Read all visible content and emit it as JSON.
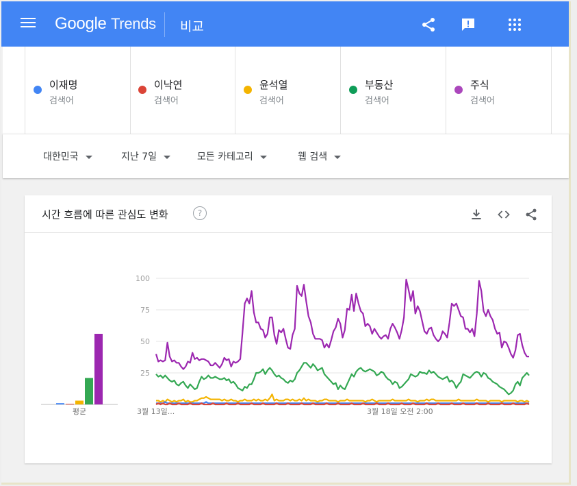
{
  "app": {
    "logo_google": "Google",
    "logo_trends": "Trends",
    "page_title": "비교",
    "icons": [
      "menu-icon",
      "share-icon",
      "feedback-icon",
      "apps-grid-icon"
    ]
  },
  "terms": [
    {
      "name": "이재명",
      "sub": "검색어",
      "color": "#4285f4"
    },
    {
      "name": "이낙연",
      "sub": "검색어",
      "color": "#db4437"
    },
    {
      "name": "윤석열",
      "sub": "검색어",
      "color": "#f4b400"
    },
    {
      "name": "부동산",
      "sub": "검색어",
      "color": "#0f9d58"
    },
    {
      "name": "주식",
      "sub": "검색어",
      "color": "#ab47bc"
    }
  ],
  "filters": {
    "region": "대한민국",
    "period": "지난 7일",
    "category": "모든 카테고리",
    "search_type": "웹 검색"
  },
  "card": {
    "title": "시간 흐름에 따른 관심도 변화",
    "help": "?"
  },
  "chart_data": {
    "type": "line",
    "ylim": [
      0,
      100
    ],
    "yticks": [
      "100",
      "75",
      "50",
      "25"
    ],
    "xtick_labels": [
      "3월 13일...",
      "3월 18일 오전 2:00"
    ],
    "average_label": "평균",
    "averages": [
      {
        "name": "이재명",
        "value": 1,
        "color": "#4285f4"
      },
      {
        "name": "이낙연",
        "value": 0,
        "color": "#db4437"
      },
      {
        "name": "윤석열",
        "value": 3,
        "color": "#f4b400"
      },
      {
        "name": "부동산",
        "value": 21,
        "color": "#34a853"
      },
      {
        "name": "주식",
        "value": 56,
        "color": "#9c27b0"
      }
    ],
    "series": [
      {
        "name": "주식",
        "color": "#9c27b0",
        "values": [
          40,
          34,
          35,
          34,
          35,
          49,
          38,
          34,
          35,
          33,
          33,
          30,
          28,
          30,
          34,
          33,
          41,
          36,
          37,
          35,
          36,
          36,
          35,
          34,
          31,
          31,
          33,
          31,
          29,
          32,
          37,
          35,
          36,
          30,
          34,
          33,
          34,
          36,
          57,
          80,
          84,
          80,
          90,
          73,
          65,
          65,
          60,
          59,
          53,
          56,
          69,
          69,
          55,
          48,
          59,
          57,
          60,
          52,
          45,
          44,
          55,
          60,
          94,
          88,
          86,
          95,
          82,
          70,
          65,
          56,
          52,
          52,
          52,
          51,
          45,
          48,
          45,
          51,
          58,
          61,
          68,
          64,
          53,
          59,
          76,
          75,
          87,
          74,
          88,
          80,
          74,
          72,
          62,
          64,
          62,
          56,
          60,
          57,
          54,
          52,
          54,
          55,
          52,
          60,
          64,
          61,
          57,
          52,
          59,
          69,
          99,
          91,
          82,
          90,
          72,
          78,
          74,
          66,
          58,
          56,
          60,
          61,
          55,
          52,
          50,
          52,
          58,
          56,
          53,
          65,
          80,
          78,
          80,
          75,
          70,
          69,
          60,
          60,
          57,
          60,
          54,
          72,
          98,
          90,
          74,
          70,
          75,
          70,
          67,
          60,
          56,
          57,
          45,
          50,
          49,
          45,
          40,
          37,
          43,
          55,
          56,
          47,
          41,
          38,
          38
        ]
      },
      {
        "name": "부동산",
        "color": "#34a853",
        "values": [
          24,
          22,
          23,
          21,
          23,
          21,
          19,
          18,
          19,
          16,
          15,
          17,
          18,
          15,
          13,
          16,
          14,
          12,
          13,
          18,
          22,
          20,
          21,
          23,
          21,
          21,
          22,
          21,
          20,
          20,
          21,
          19,
          20,
          17,
          18,
          16,
          13,
          12,
          11,
          14,
          13,
          16,
          16,
          20,
          25,
          25,
          26,
          28,
          24,
          27,
          29,
          27,
          24,
          22,
          23,
          21,
          20,
          18,
          17,
          19,
          18,
          20,
          25,
          27,
          30,
          33,
          33,
          31,
          29,
          32,
          30,
          27,
          28,
          29,
          24,
          22,
          20,
          18,
          16,
          17,
          12,
          15,
          13,
          12,
          16,
          20,
          24,
          22,
          26,
          28,
          29,
          27,
          26,
          27,
          28,
          27,
          26,
          23,
          24,
          26,
          25,
          22,
          20,
          19,
          16,
          18,
          17,
          13,
          14,
          16,
          18,
          20,
          24,
          23,
          22,
          23,
          26,
          25,
          25,
          24,
          27,
          25,
          26,
          24,
          22,
          21,
          20,
          21,
          22,
          18,
          19,
          17,
          13,
          16,
          18,
          24,
          23,
          22,
          21,
          23,
          25,
          26,
          25,
          22,
          25,
          24,
          21,
          20,
          18,
          17,
          16,
          14,
          13,
          12,
          10,
          8,
          9,
          11,
          16,
          18,
          15,
          21,
          23,
          25,
          23
        ]
      },
      {
        "name": "윤석열",
        "color": "#f4b400",
        "values": [
          3,
          3,
          2,
          3,
          2,
          4,
          3,
          2,
          3,
          2,
          3,
          3,
          4,
          2,
          3,
          2,
          2,
          3,
          3,
          4,
          5,
          5,
          6,
          5,
          4,
          4,
          4,
          4,
          4,
          3,
          4,
          3,
          3,
          4,
          3,
          3,
          2,
          3,
          3,
          4,
          3,
          3,
          3,
          4,
          3,
          4,
          3,
          3,
          4,
          3,
          5,
          8,
          3,
          4,
          3,
          3,
          3,
          4,
          4,
          3,
          4,
          3,
          3,
          4,
          3,
          5,
          3,
          4,
          3,
          3,
          3,
          2,
          3,
          3,
          4,
          4,
          3,
          3,
          3,
          3,
          2,
          3,
          3,
          3,
          4,
          3,
          3,
          3,
          3,
          3,
          3,
          3,
          2,
          3,
          3,
          4,
          3,
          2,
          3,
          3,
          3,
          3,
          3,
          3,
          4,
          3,
          3,
          3,
          3,
          3,
          3,
          4,
          3,
          3,
          3,
          2,
          3,
          3,
          3,
          4,
          3,
          4,
          4,
          3,
          3,
          3,
          3,
          3,
          3,
          3,
          3,
          3,
          3,
          4,
          3,
          3,
          3,
          3,
          3,
          3,
          3,
          4,
          3,
          3,
          3,
          3,
          2,
          3,
          3,
          3,
          3,
          3,
          2,
          3,
          3,
          3,
          3,
          3,
          3,
          2,
          3,
          3,
          2,
          3,
          2
        ]
      },
      {
        "name": "이재명",
        "color": "#4285f4",
        "values": [
          1,
          1,
          1,
          1,
          2,
          1,
          1,
          1,
          1,
          1,
          1,
          1,
          1,
          1,
          1,
          1,
          1,
          1,
          1,
          1,
          1,
          1,
          2,
          1,
          1,
          1,
          1,
          1,
          1,
          1,
          1,
          1,
          1,
          1,
          1,
          1,
          1,
          1,
          1,
          1,
          1,
          1,
          1,
          1,
          1,
          1,
          1,
          1,
          1,
          1,
          1,
          1,
          1,
          1,
          1,
          1,
          1,
          1,
          1,
          1,
          1,
          1,
          1,
          1,
          1,
          1,
          1,
          1,
          1,
          1,
          1,
          1,
          1,
          1,
          1,
          1,
          1,
          1,
          1,
          1,
          1,
          1,
          1,
          1,
          1,
          1,
          1,
          1,
          1,
          1,
          1,
          1,
          1,
          1,
          1,
          1,
          1,
          1,
          1,
          1,
          1,
          1,
          1,
          1,
          1,
          1,
          1,
          1,
          1,
          1,
          1,
          1,
          1,
          1,
          1,
          1,
          1,
          1,
          1,
          1,
          1,
          1,
          1,
          1,
          1,
          1,
          1,
          1,
          1,
          1,
          1,
          1,
          1,
          1,
          1,
          1,
          1,
          1,
          1,
          1,
          1,
          1,
          1,
          1,
          1,
          1,
          1,
          1,
          1,
          1,
          1,
          1,
          1,
          1,
          1,
          1,
          1,
          1,
          1,
          1,
          1,
          1,
          1,
          1,
          1
        ]
      },
      {
        "name": "이낙연",
        "color": "#db4437",
        "values": [
          0,
          1,
          0,
          1,
          0,
          0,
          1,
          0,
          0,
          0,
          1,
          0,
          0,
          0,
          0,
          1,
          0,
          0,
          0,
          0,
          1,
          0,
          0,
          0,
          0,
          1,
          0,
          0,
          0,
          0,
          0,
          1,
          0,
          0,
          0,
          0,
          1,
          0,
          0,
          0,
          0,
          0,
          1,
          0,
          0,
          0,
          0,
          1,
          0,
          0,
          0,
          0,
          0,
          1,
          0,
          0,
          0,
          0,
          1,
          0,
          0,
          0,
          0,
          0,
          1,
          0,
          0,
          0,
          0,
          1,
          0,
          0,
          0,
          0,
          0,
          1,
          0,
          0,
          0,
          0,
          1,
          0,
          0,
          0,
          0,
          0,
          1,
          0,
          0,
          0,
          0,
          1,
          0,
          0,
          0,
          0,
          0,
          1,
          0,
          0,
          0,
          0,
          1,
          0,
          0,
          0,
          0,
          0,
          1,
          0,
          0,
          0,
          0,
          1,
          0,
          0,
          0,
          0,
          0,
          1,
          0,
          0,
          0,
          0,
          1,
          0,
          0,
          0,
          0,
          0,
          1,
          0,
          0,
          0,
          0,
          1,
          0,
          0,
          0,
          0,
          0,
          1,
          0,
          0,
          0,
          0,
          1,
          0,
          0,
          0,
          0,
          0,
          1,
          0,
          0,
          0,
          0,
          1,
          0,
          0,
          0,
          0,
          0,
          1,
          0
        ]
      }
    ]
  }
}
